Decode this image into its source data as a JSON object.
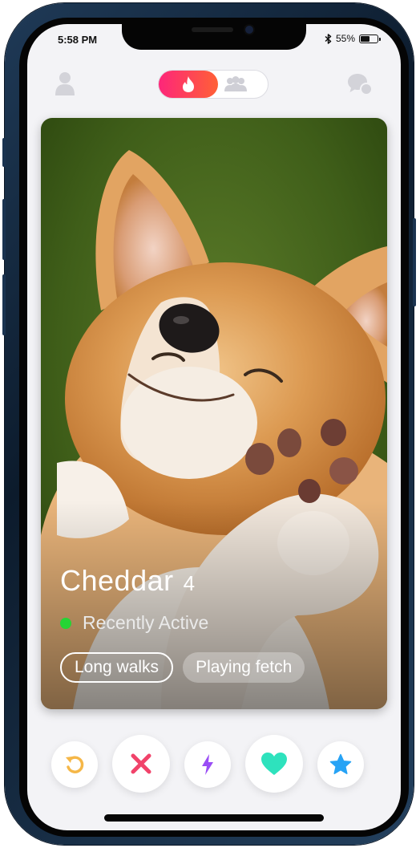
{
  "status_bar": {
    "time": "5:58 PM",
    "battery_percent": "55%",
    "battery_level": 0.55
  },
  "top_bar": {
    "profile_icon": "person-icon",
    "mode_active_icon": "flame-icon",
    "mode_inactive_icon": "group-icon",
    "messages_icon": "chat-bubbles-icon"
  },
  "card": {
    "name": "Cheddar",
    "age": "4",
    "activity_status": "Recently Active",
    "interests": [
      "Long walks",
      "Playing fetch"
    ]
  },
  "actions": [
    {
      "name": "rewind",
      "icon": "rewind-icon",
      "color": "#f5b748"
    },
    {
      "name": "nope",
      "icon": "x-icon",
      "color": "#f1436a"
    },
    {
      "name": "boost",
      "icon": "lightning-icon",
      "color": "#9a4df5"
    },
    {
      "name": "like",
      "icon": "heart-icon",
      "color": "#2ee2bd"
    },
    {
      "name": "super-like",
      "icon": "star-icon",
      "color": "#27a3f5"
    }
  ],
  "colors": {
    "brand_gradient_start": "#fd267a",
    "brand_gradient_end": "#ff6036",
    "active_dot": "#25d435"
  }
}
